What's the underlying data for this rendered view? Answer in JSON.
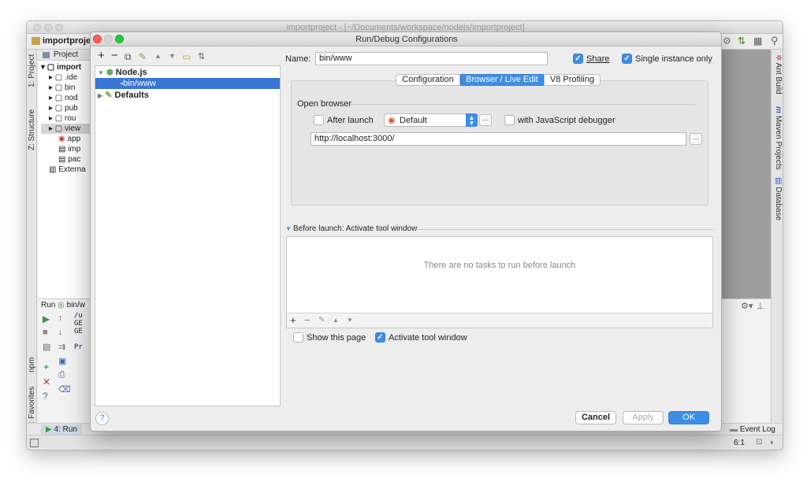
{
  "ide": {
    "window_title": "importproject - [~/Documents/workspace/nodejs/importproject]",
    "nav_project": "importproject",
    "project_tab": "Project",
    "tree": [
      "import",
      ".ide",
      "bin",
      "nod",
      "pub",
      "rou",
      "view",
      "app",
      "imp",
      "pac",
      "Externa"
    ],
    "left_tools": [
      "1: Project",
      "Z: Structure",
      "npm",
      "2: Favorites"
    ],
    "right_tools": [
      "Ant Build",
      "Maven Projects",
      "Database"
    ],
    "run_header_prefix": "Run",
    "run_header_config": "bin/w",
    "console_lines": [
      "/u",
      "GE",
      "GE",
      "",
      "Pr"
    ],
    "run_tab": "4: Run",
    "event_log": "Event Log",
    "caret_position": "6:1"
  },
  "dialog": {
    "title": "Run/Debug Configurations",
    "tree": {
      "nodejs_label": "Node.js",
      "config_label": "bin/www",
      "defaults_label": "Defaults"
    },
    "name_label": "Name:",
    "name_value": "bin/www",
    "share_label": "Share",
    "single_instance_label": "Single instance only",
    "tabs": [
      "Configuration",
      "Browser / Live Edit",
      "V8 Profiling"
    ],
    "open_browser_label": "Open browser",
    "after_launch_label": "After launch",
    "browser_value": "Default",
    "js_debugger_label": "with JavaScript debugger",
    "url_value": "http://localhost:3000/",
    "before_launch_label": "Before launch: Activate tool window",
    "no_tasks_text": "There are no tasks to run before launch",
    "show_page_label": "Show this page",
    "activate_window_label": "Activate tool window",
    "cancel_label": "Cancel",
    "apply_label": "Apply",
    "ok_label": "OK",
    "help_label": "?"
  },
  "colors": {
    "accent": "#3d8de3",
    "selection": "#3875d7"
  }
}
